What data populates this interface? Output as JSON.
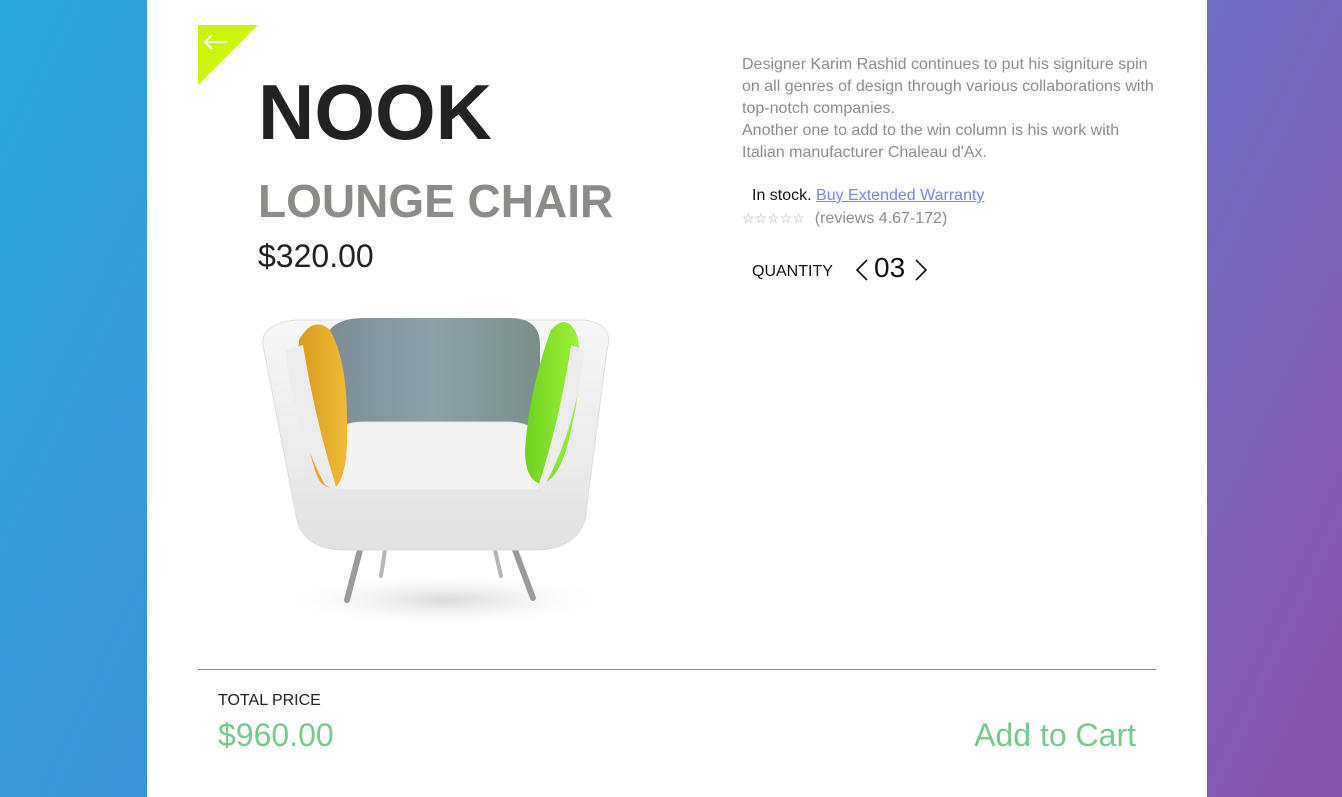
{
  "product": {
    "name": "NOOK",
    "type": "LOUNGE CHAIR",
    "price": "$320.00",
    "image_icon": "lounge-chair-image"
  },
  "description": {
    "paragraph1": "Designer Karim Rashid continues to put his signiture spin on all genres of design through various collaborations with top-notch companies.",
    "paragraph2": "Another one to add to the win column is his work with Italian manufacturer Chaleau d'Ax."
  },
  "availability": {
    "stock_text": "In stock.",
    "warranty_link": "Buy Extended Warranty"
  },
  "rating": {
    "stars": "☆☆☆☆☆",
    "reviews_text": "(reviews 4.67-172)"
  },
  "quantity": {
    "label": "QUANTITY",
    "value": "03"
  },
  "total": {
    "label": "TOTAL PRICE",
    "value": "$960.00"
  },
  "actions": {
    "add_to_cart": "Add to Cart"
  },
  "colors": {
    "accent_lime": "#ccf500",
    "accent_green": "#77c98d",
    "link": "#7b86e0"
  },
  "icons": {
    "back": "arrow-left-icon",
    "prev": "chevron-left-icon",
    "next": "chevron-right-icon"
  }
}
